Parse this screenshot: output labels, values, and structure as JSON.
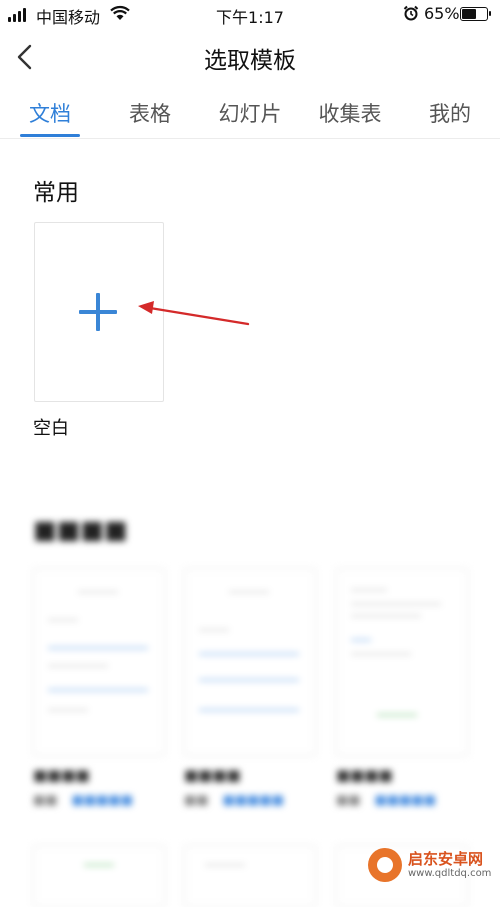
{
  "status_bar": {
    "carrier": "中国移动",
    "time": "下午1:17",
    "battery_percent": "65%",
    "battery_level": 0.65
  },
  "nav": {
    "title": "选取模板"
  },
  "tabs": [
    {
      "label": "文档",
      "active": true
    },
    {
      "label": "表格",
      "active": false
    },
    {
      "label": "幻灯片",
      "active": false
    },
    {
      "label": "收集表",
      "active": false
    },
    {
      "label": "我的",
      "active": false
    }
  ],
  "common": {
    "title": "常用",
    "blank_label": "空白"
  },
  "colors": {
    "accent": "#2f7fd8",
    "annotation_arrow": "#d42a2a"
  },
  "watermark": {
    "text": "启东安卓网",
    "url": "www.qdltdq.com"
  }
}
